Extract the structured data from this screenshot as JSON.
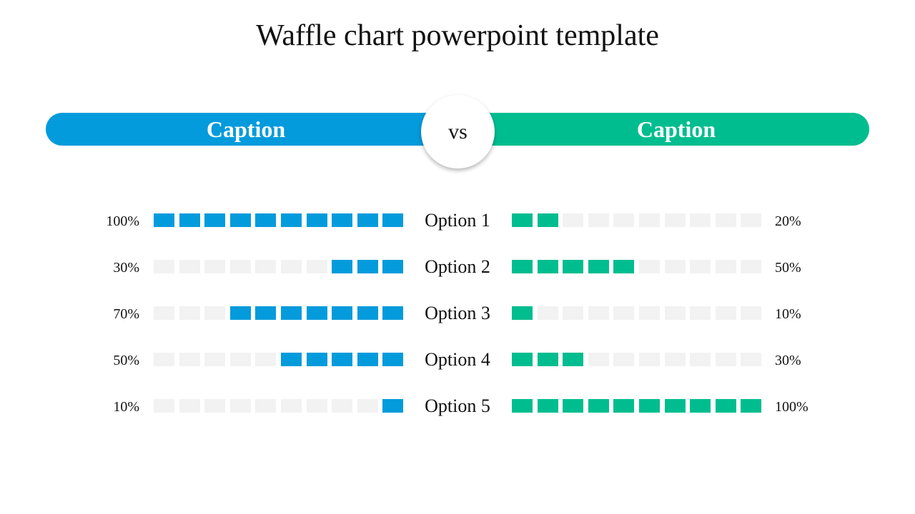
{
  "title": "Waffle chart powerpoint template",
  "banner": {
    "left_caption": "Caption",
    "right_caption": "Caption",
    "vs_label": "vs",
    "left_color": "#039bdc",
    "right_color": "#00bd8f",
    "empty_color": "#f2f2f2"
  },
  "chart_data": {
    "type": "bar",
    "subtype": "waffle",
    "title": "Waffle chart powerpoint template",
    "categories": [
      "Option 1",
      "Option 2",
      "Option 3",
      "Option 4",
      "Option 5"
    ],
    "cells_per_row": 10,
    "series": [
      {
        "name": "Caption (left)",
        "color": "#039bdc",
        "direction": "right-to-left",
        "values": [
          100,
          30,
          70,
          50,
          10
        ],
        "labels": [
          "100%",
          "30%",
          "70%",
          "50%",
          "10%"
        ]
      },
      {
        "name": "Caption (right)",
        "color": "#00bd8f",
        "direction": "left-to-right",
        "values": [
          20,
          50,
          10,
          30,
          100
        ],
        "labels": [
          "20%",
          "50%",
          "10%",
          "30%",
          "100%"
        ]
      }
    ],
    "ylim": [
      0,
      100
    ],
    "legend": "top"
  }
}
